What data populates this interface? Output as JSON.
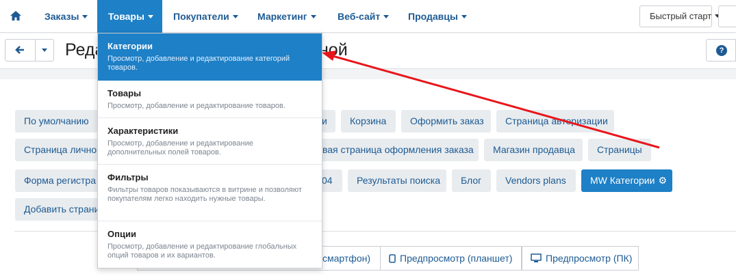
{
  "nav": {
    "items": [
      {
        "label": "Заказы"
      },
      {
        "label": "Товары"
      },
      {
        "label": "Покупатели"
      },
      {
        "label": "Маркетинг"
      },
      {
        "label": "Веб-сайт"
      },
      {
        "label": "Продавцы"
      }
    ],
    "quick_start": "Быстрый старт"
  },
  "header": {
    "title_start": "Реда",
    "title_end": "ной"
  },
  "dropdown": [
    {
      "title": "Категории",
      "desc": "Просмотр, добавление и редактирование категорий товаров."
    },
    {
      "title": "Товары",
      "desc": "Просмотр, добавление и редактирование товаров."
    },
    {
      "title": "Характеристики",
      "desc": "Просмотр, добавление и редактирование дополнительных полей товаров."
    },
    {
      "title": "Фильтры",
      "desc": "Фильтры товаров показываются в витрине и позволяют покупателям легко находить нужные товары."
    },
    {
      "title": "Опции",
      "desc": "Просмотр, добавление и редактирование глобальных опций товаров и их вариантов."
    }
  ],
  "layouts": {
    "row1": [
      "По умолчанию",
      "и",
      "Корзина",
      "Оформить заказ",
      "Страница авторизации"
    ],
    "row2": [
      "Страница личной",
      "левая страница оформления заказа",
      "Магазин продавца",
      "Страницы"
    ],
    "row3": [
      "Форма регистра",
      "04",
      "Результаты поиска",
      "Блог",
      "Vendors plans",
      "MW Категории"
    ],
    "row4": [
      "Добавить страни"
    ]
  },
  "preview": {
    "smartphone": "смартфон)",
    "tablet": "Предпросмотр (планшет)",
    "pc": "Предпросмотр (ПК)"
  },
  "colors": {
    "accent": "#1e80c6",
    "link": "#1d5a93",
    "annotation": "#e8161b"
  },
  "icons": [
    "home-icon",
    "arrow-left-icon",
    "question-circle-icon",
    "gear-icon",
    "mobile-icon",
    "tablet-icon",
    "desktop-icon"
  ]
}
